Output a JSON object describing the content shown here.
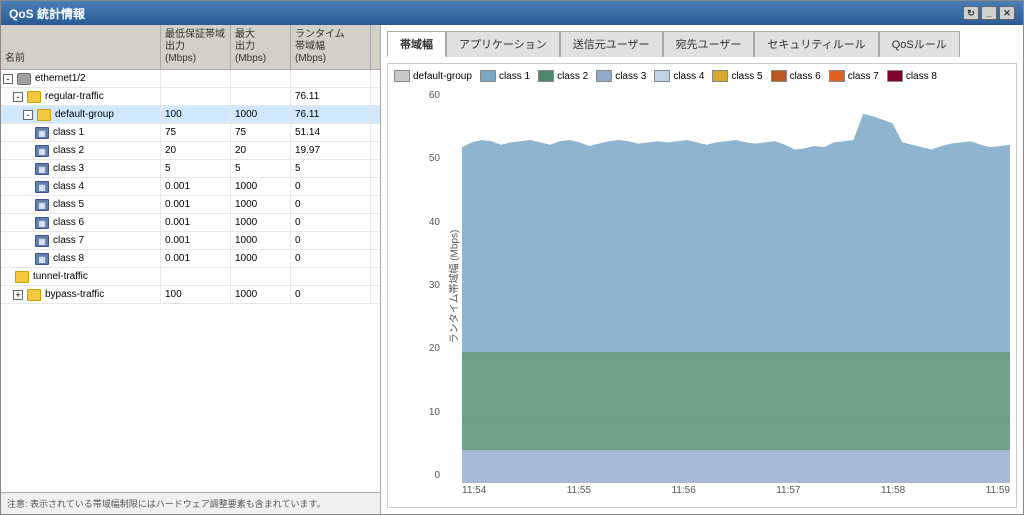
{
  "window": {
    "title": "QoS 統計情報",
    "controls": [
      "refresh",
      "minimize",
      "close"
    ]
  },
  "table": {
    "columns": [
      "名前",
      "最低保証帯域出力\n(Mbps)",
      "最大\n出力\n(Mbps)",
      "ランタイム\n帯域幅\n(Mbps)"
    ],
    "col_headers": {
      "name": "名前",
      "min_bw": "最低保証帯域\n出力\n(Mbps)",
      "max_out": "最大\n出力\n(Mbps)",
      "runtime": "ランタイム\n帯域幅\n(Mbps)"
    },
    "rows": [
      {
        "level": 1,
        "name": "ethernet1/2",
        "min": "",
        "max": "",
        "runtime": "",
        "type": "interface"
      },
      {
        "level": 2,
        "name": "regular-traffic",
        "min": "",
        "max": "",
        "runtime": "76.11",
        "type": "group"
      },
      {
        "level": 3,
        "name": "default-group",
        "min": "100",
        "max": "1000",
        "runtime": "76.11",
        "type": "folder",
        "selected": true
      },
      {
        "level": 4,
        "name": "class 1",
        "min": "75",
        "max": "75",
        "runtime": "51.14",
        "type": "class"
      },
      {
        "level": 4,
        "name": "class 2",
        "min": "20",
        "max": "20",
        "runtime": "19.97",
        "type": "class"
      },
      {
        "level": 4,
        "name": "class 3",
        "min": "5",
        "max": "5",
        "runtime": "5",
        "type": "class"
      },
      {
        "level": 4,
        "name": "class 4",
        "min": "0.001",
        "max": "1000",
        "runtime": "0",
        "type": "class"
      },
      {
        "level": 4,
        "name": "class 5",
        "min": "0.001",
        "max": "1000",
        "runtime": "0",
        "type": "class"
      },
      {
        "level": 4,
        "name": "class 6",
        "min": "0.001",
        "max": "1000",
        "runtime": "0",
        "type": "class"
      },
      {
        "level": 4,
        "name": "class 7",
        "min": "0.001",
        "max": "1000",
        "runtime": "0",
        "type": "class"
      },
      {
        "level": 4,
        "name": "class 8",
        "min": "0.001",
        "max": "1000",
        "runtime": "0",
        "type": "class"
      },
      {
        "level": 2,
        "name": "tunnel-traffic",
        "min": "",
        "max": "",
        "runtime": "",
        "type": "group"
      },
      {
        "level": 2,
        "name": "bypass-traffic",
        "min": "100",
        "max": "1000",
        "runtime": "0",
        "type": "group"
      }
    ],
    "footer": "注意: 表示されている帯域幅制限にはハードウェア調整要素も含まれています。"
  },
  "tabs": [
    "帯域幅",
    "アプリケーション",
    "送信元ユーザー",
    "宛先ユーザー",
    "セキュリティルール",
    "QoSルール"
  ],
  "active_tab": "帯域幅",
  "legend": [
    {
      "label": "default-group",
      "color": "#c0c0c0"
    },
    {
      "label": "class 1",
      "color": "#7ba7c7"
    },
    {
      "label": "class 2",
      "color": "#4a8a6a"
    },
    {
      "label": "class 3",
      "color": "#a0b8d0"
    },
    {
      "label": "class 4",
      "color": "#c8d8e8"
    },
    {
      "label": "class 5",
      "color": "#d4a830"
    },
    {
      "label": "class 6",
      "color": "#b85820"
    },
    {
      "label": "class 7",
      "color": "#e06020"
    },
    {
      "label": "class 8",
      "color": "#800030"
    }
  ],
  "chart": {
    "y_axis": {
      "label": "ランタイム帯域幅 (Mbps)",
      "values": [
        0,
        10,
        20,
        30,
        40,
        50,
        60
      ]
    },
    "x_axis": [
      "11:54",
      "11:55",
      "11:56",
      "11:57",
      "11:58",
      "11:59"
    ]
  }
}
